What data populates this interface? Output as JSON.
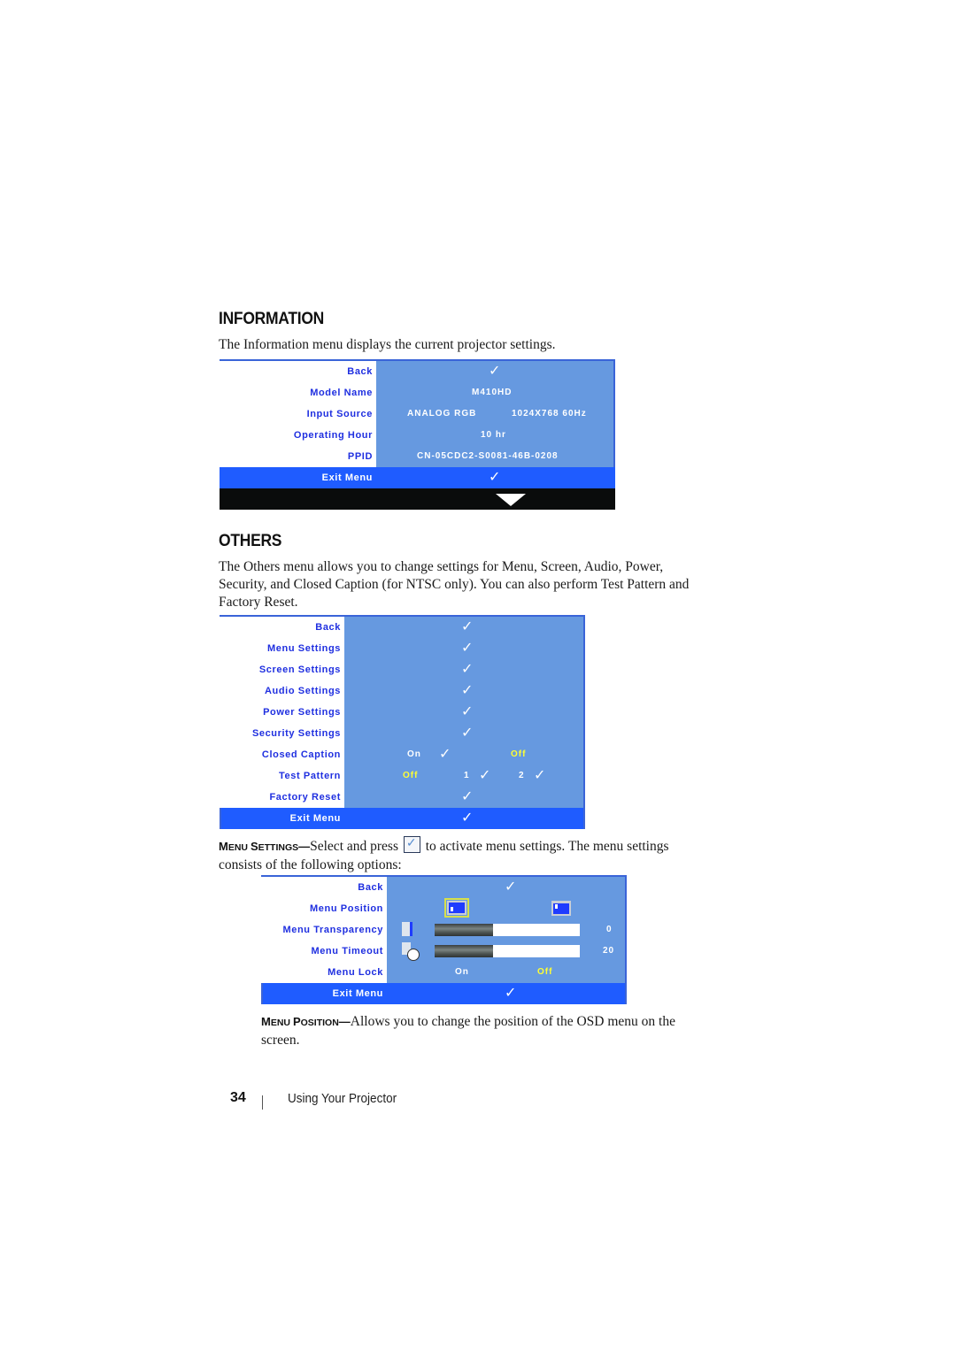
{
  "information": {
    "heading": "INFORMATION",
    "description": "The Information menu displays the current projector settings.",
    "menu": {
      "rows": [
        {
          "label": "Back",
          "value": "✓"
        },
        {
          "label": "Model Name",
          "value": "M410HD"
        },
        {
          "label": "Input Source",
          "value": "ANALOG RGB",
          "value2": "1024X768 60Hz"
        },
        {
          "label": "Operating Hour",
          "value": "10 hr"
        },
        {
          "label": "PPID",
          "value": "CN-05CDC2-S0081-46B-0208"
        }
      ],
      "exit": {
        "label": "Exit Menu",
        "value": "✓"
      },
      "scroll_indicator": "down-arrow"
    }
  },
  "others": {
    "heading": "OTHERS",
    "description": "The Others menu allows you to change settings for Menu, Screen, Audio, Power, Security, and Closed Caption (for NTSC only). You can also perform Test Pattern and Factory Reset.",
    "menu": {
      "rows": [
        {
          "label": "Back",
          "value": "✓"
        },
        {
          "label": "Menu Settings",
          "value": "✓"
        },
        {
          "label": "Screen Settings",
          "value": "✓"
        },
        {
          "label": "Audio Settings",
          "value": "✓"
        },
        {
          "label": "Power Settings",
          "value": "✓"
        },
        {
          "label": "Security Settings",
          "value": "✓"
        }
      ],
      "closed_caption": {
        "label": "Closed Caption",
        "on": "On",
        "on_check": "✓",
        "off": "Off",
        "selected": "Off"
      },
      "test_pattern": {
        "label": "Test Pattern",
        "off": "Off",
        "opt1": "1",
        "opt1_check": "✓",
        "opt2": "2",
        "opt2_check": "✓",
        "selected": "Off"
      },
      "factory_reset": {
        "label": "Factory Reset",
        "value": "✓"
      },
      "exit": {
        "label": "Exit Menu",
        "value": "✓"
      }
    }
  },
  "menu_settings": {
    "term_prefix": "M",
    "term_rest": "ENU ",
    "term2_prefix": "S",
    "term2_rest": "ETTINGS",
    "dash": "—",
    "text_before_icon": "Select and press",
    "text_after_icon": "to activate menu settings. The menu settings consists of the following options:",
    "menu": {
      "back": {
        "label": "Back",
        "value": "✓"
      },
      "menu_position": {
        "label": "Menu Position",
        "options": [
          "bottom-left",
          "top-left"
        ],
        "selected": "bottom-left"
      },
      "menu_transparency": {
        "label": "Menu Transparency",
        "value": "0",
        "fill_percent": 40
      },
      "menu_timeout": {
        "label": "Menu Timeout",
        "value": "20",
        "fill_percent": 40
      },
      "menu_lock": {
        "label": "Menu Lock",
        "on": "On",
        "off": "Off",
        "selected": "Off"
      },
      "exit": {
        "label": "Exit Menu",
        "value": "✓"
      }
    }
  },
  "menu_position": {
    "term_prefix": "M",
    "term_rest": "ENU ",
    "term2_prefix": "P",
    "term2_rest": "OSITION",
    "dash": "—",
    "text": "Allows you to change the position of the OSD menu on the screen."
  },
  "footer": {
    "page_number": "34",
    "section_title": "Using Your Projector"
  }
}
